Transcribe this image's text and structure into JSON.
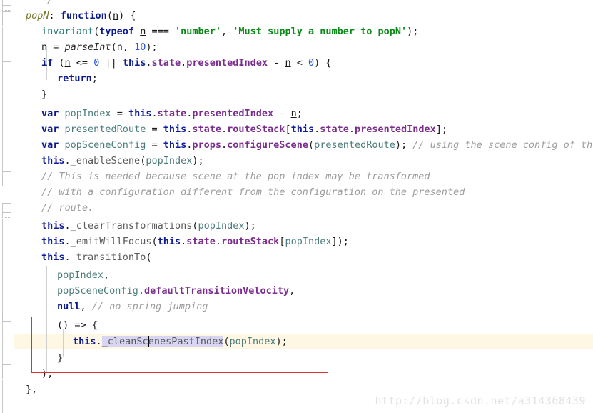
{
  "editor": {
    "language": "JavaScript",
    "background_color": "#ffffff",
    "current_line_highlight_color": "#fdf7e3",
    "annotation_box_color": "#e03030",
    "caret_color": "#000000",
    "identifier_highlight_color": "#d7d5f2",
    "gutter_border_color": "#d7d7d7",
    "indent_guide_color": "#d0d0d0",
    "font_size_px": 13.5,
    "line_height_px": 22
  },
  "watermark": {
    "text": "http://blog.csdn.net/a314368439",
    "color": "#e2e2e2"
  },
  "caret": {
    "line_index": 22,
    "identifier_under_caret": "_cleanScenesPastIndex"
  },
  "annotation": {
    "kind": "red-rectangle",
    "covers_lines": [
      21,
      22,
      23
    ],
    "label": "highlighted-callback-block"
  },
  "code": {
    "lines": [
      {
        "n": 0,
        "indent": 2,
        "text": "*/"
      },
      {
        "n": 1,
        "indent": 1,
        "text": "popN: function(n) {"
      },
      {
        "n": 2,
        "indent": 2,
        "text": "invariant(typeof n === 'number', 'Must supply a number to popN');"
      },
      {
        "n": 3,
        "indent": 2,
        "text": "n = parseInt(n, 10);"
      },
      {
        "n": 4,
        "indent": 2,
        "text": "if (n <= 0 || this.state.presentedIndex - n < 0) {"
      },
      {
        "n": 5,
        "indent": 3,
        "text": "return;"
      },
      {
        "n": 6,
        "indent": 2,
        "text": "}"
      },
      {
        "n": 7,
        "indent": 2,
        "text": "var popIndex = this.state.presentedIndex - n;"
      },
      {
        "n": 8,
        "indent": 2,
        "text": "var presentedRoute = this.state.routeStack[this.state.presentedIndex];"
      },
      {
        "n": 9,
        "indent": 2,
        "text": "var popSceneConfig = this.props.configureScene(presentedRoute); // using the scene config of the"
      },
      {
        "n": 10,
        "indent": 2,
        "text": "this._enableScene(popIndex);"
      },
      {
        "n": 11,
        "indent": 2,
        "text": "// This is needed because scene at the pop index may be transformed"
      },
      {
        "n": 12,
        "indent": 2,
        "text": "// with a configuration different from the configuration on the presented"
      },
      {
        "n": 13,
        "indent": 2,
        "text": "// route."
      },
      {
        "n": 14,
        "indent": 2,
        "text": "this._clearTransformations(popIndex);"
      },
      {
        "n": 15,
        "indent": 2,
        "text": "this._emitWillFocus(this.state.routeStack[popIndex]);"
      },
      {
        "n": 16,
        "indent": 2,
        "text": "this._transitionTo("
      },
      {
        "n": 17,
        "indent": 3,
        "text": "popIndex,"
      },
      {
        "n": 18,
        "indent": 3,
        "text": "popSceneConfig.defaultTransitionVelocity,"
      },
      {
        "n": 19,
        "indent": 3,
        "text": "null, // no spring jumping"
      },
      {
        "n": 20,
        "indent": 3,
        "text": "() => {"
      },
      {
        "n": 21,
        "indent": 4,
        "text": "this._cleanScenesPastIndex(popIndex);"
      },
      {
        "n": 22,
        "indent": 3,
        "text": "}"
      },
      {
        "n": 23,
        "indent": 2,
        "text": ");"
      },
      {
        "n": 24,
        "indent": 1,
        "text": "},"
      }
    ],
    "tokens": {
      "keywords": [
        "function",
        "var",
        "if",
        "return",
        "typeof",
        "null"
      ],
      "this_keyword": "this",
      "strings": [
        "'number'",
        "'Must supply a number to popN'"
      ],
      "numbers": [
        "10",
        "0"
      ],
      "properties": [
        "state",
        "presentedIndex",
        "routeStack",
        "props",
        "configureScene",
        "defaultTransitionVelocity"
      ],
      "functions": [
        "popN",
        "invariant",
        "parseInt",
        "_enableScene",
        "_clearTransformations",
        "_emitWillFocus",
        "_transitionTo",
        "_cleanScenesPastIndex"
      ],
      "identifiers": [
        "n",
        "popIndex",
        "presentedRoute",
        "popSceneConfig"
      ],
      "comments": [
        "// using the scene config of the",
        "// This is needed because scene at the pop index may be transformed",
        "// with a configuration different from the configuration on the presented",
        "// route.",
        "// no spring jumping"
      ]
    },
    "colors": {
      "keyword": "#0a1a8c",
      "this": "#101e96",
      "property": "#7b2d8e",
      "string": "#0b8a18",
      "number": "#2b56e0",
      "comment": "#9d9d9d",
      "function_call": "#2f7f7f",
      "identifier": "#4b7b7b",
      "plain": "#1a1a1a"
    }
  }
}
